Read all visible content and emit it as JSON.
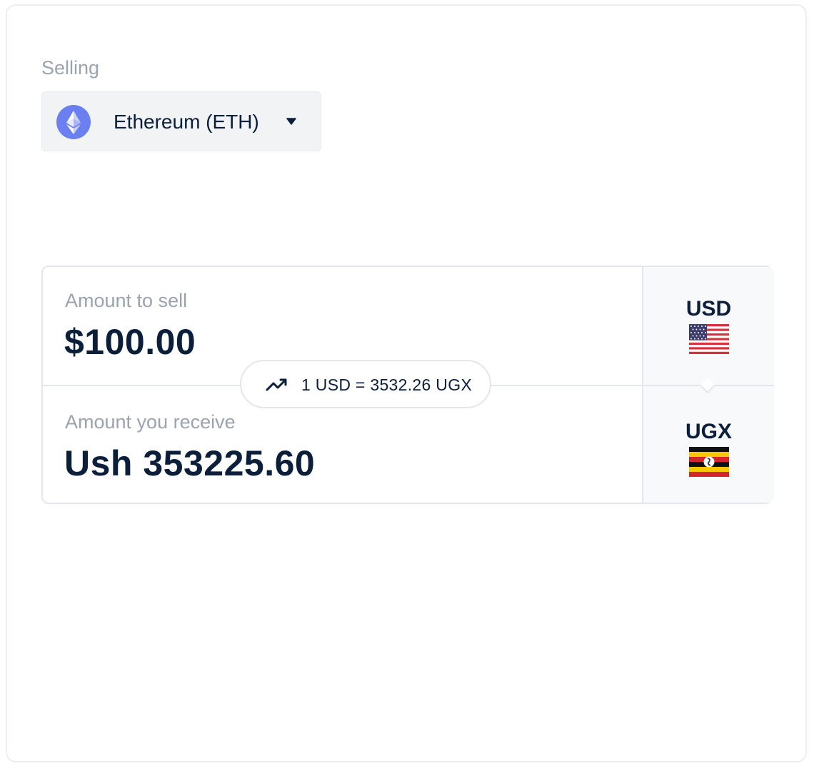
{
  "selling": {
    "label": "Selling",
    "asset": {
      "name": "Ethereum (ETH)",
      "icon": "ethereum-icon",
      "icon_color": "#6b7ff0"
    }
  },
  "converter": {
    "sell": {
      "label": "Amount to sell",
      "value": "$100.00",
      "currency_code": "USD",
      "flag": "us-flag-icon"
    },
    "receive": {
      "label": "Amount you receive",
      "value": "Ush 353225.60",
      "currency_code": "UGX",
      "flag": "uganda-flag-icon"
    },
    "rate": {
      "text": "1 USD = 3532.26 UGX",
      "icon": "trending-up-icon"
    }
  },
  "colors": {
    "text_primary": "#0b1f3a",
    "text_muted": "#9aa3ae",
    "border": "#e3e6ea",
    "select_bg": "#f1f3f5"
  }
}
